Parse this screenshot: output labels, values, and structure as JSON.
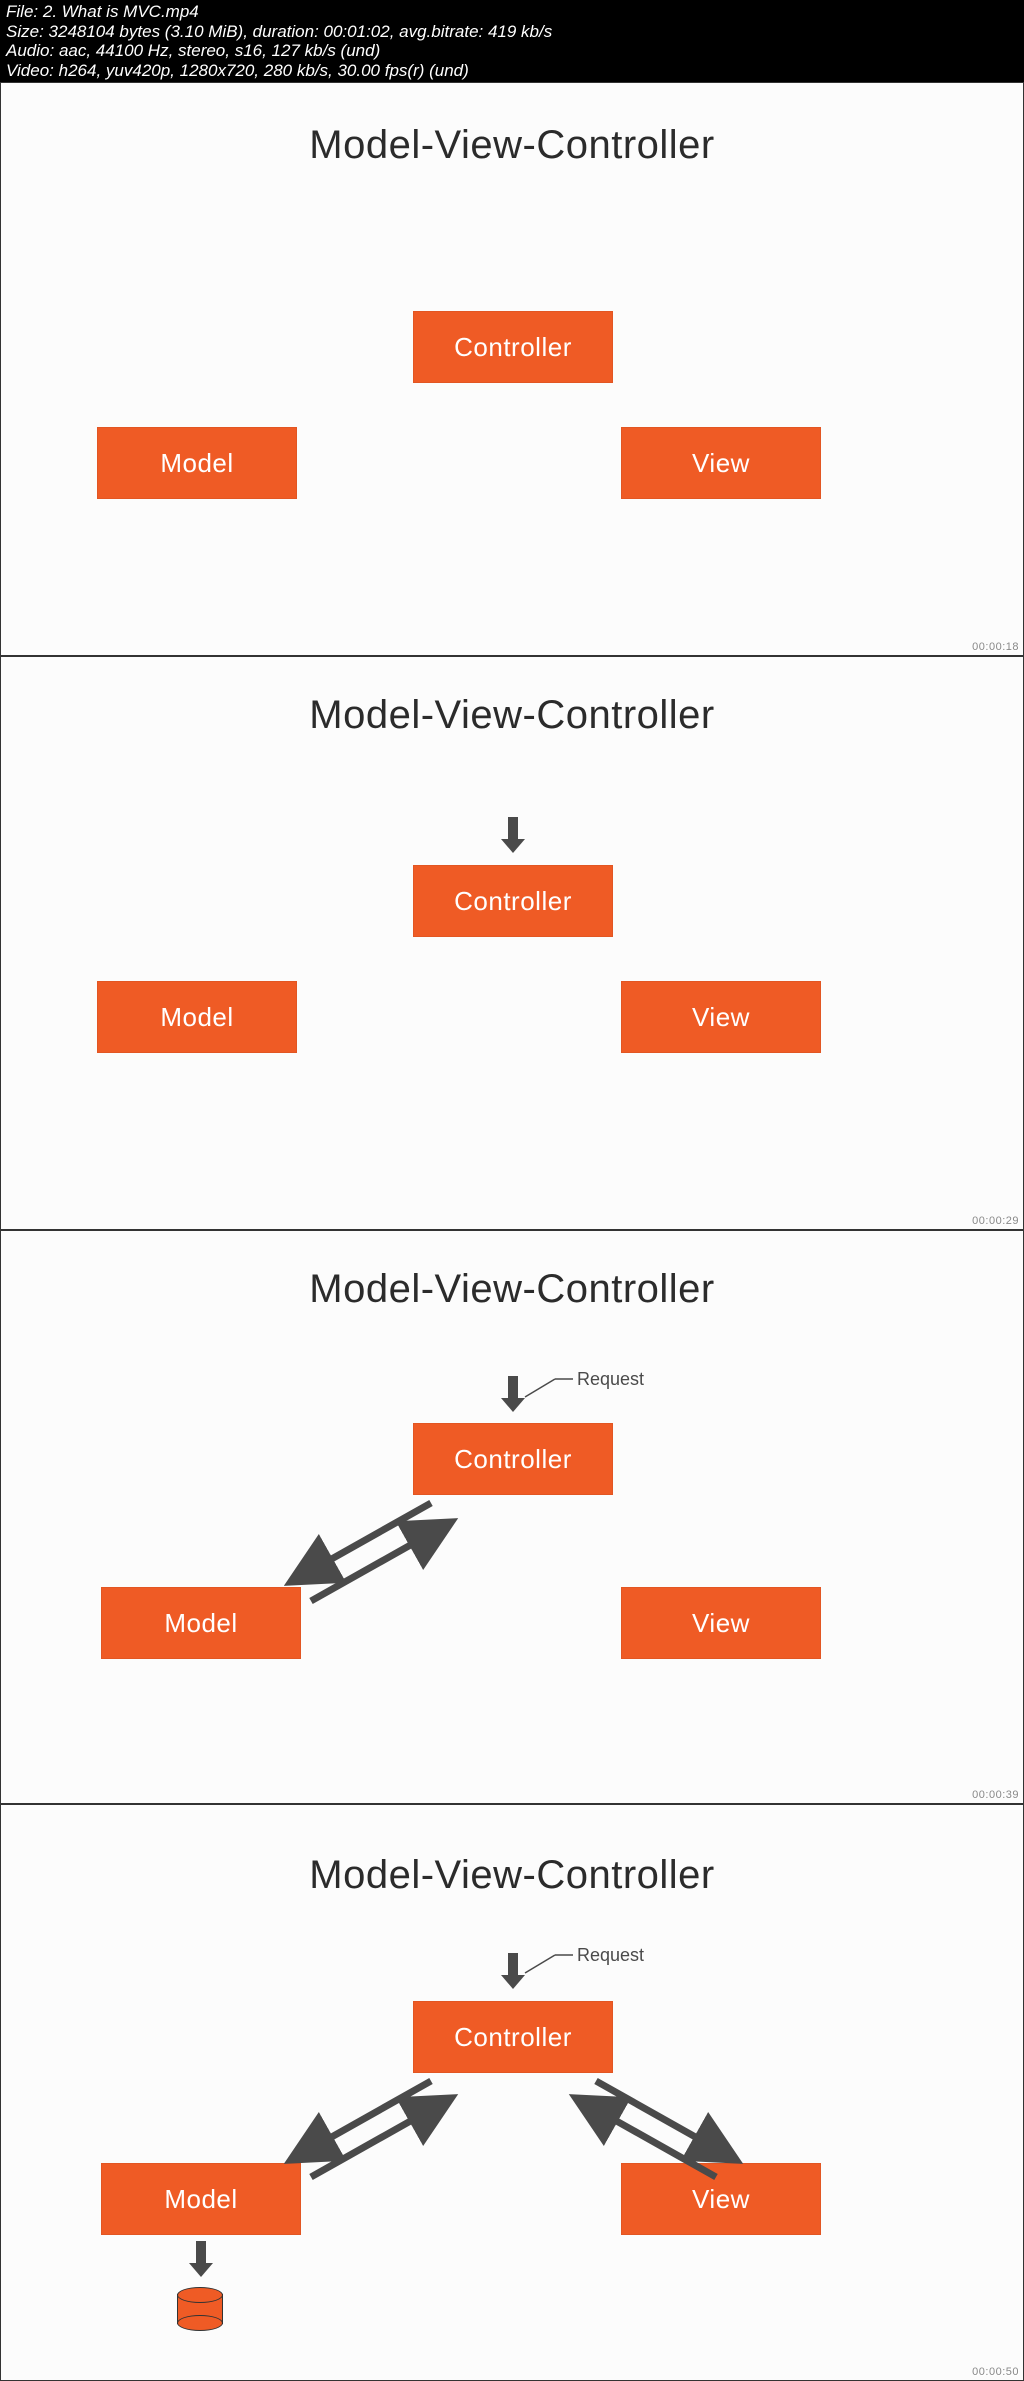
{
  "header": {
    "file_label": "File:",
    "file_name": "2. What is MVC.mp4",
    "size_label": "Size:",
    "size_value": "3248104 bytes (3.10 MiB), duration: 00:01:02, avg.bitrate: 419 kb/s",
    "audio_label": "Audio:",
    "audio_value": "aac, 44100 Hz, stereo, s16, 127 kb/s (und)",
    "video_label": "Video:",
    "video_value": "h264, yuv420p, 1280x720, 280 kb/s, 30.00 fps(r) (und)"
  },
  "slides": {
    "title": "Model-View-Controller",
    "controller": "Controller",
    "model": "Model",
    "view": "View",
    "request": "Request"
  },
  "timestamps": {
    "f1": "00:00:18",
    "f2": "00:00:29",
    "f3": "00:00:39",
    "f4": "00:00:50"
  }
}
